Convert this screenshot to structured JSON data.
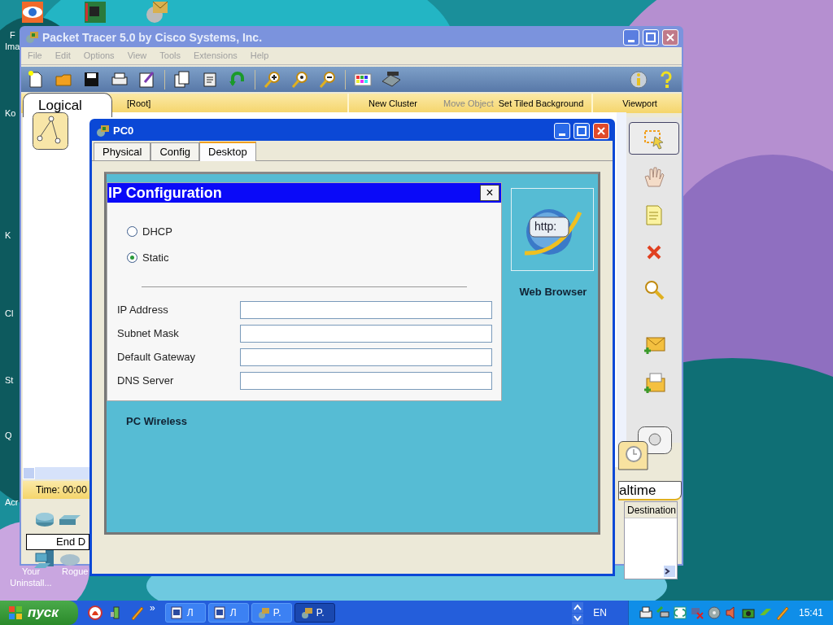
{
  "desktop": {
    "icon_labels": [
      {
        "text": "F"
      },
      {
        "text": "Ima"
      },
      {
        "text": "Ko"
      },
      {
        "text": "K"
      },
      {
        "text": "Cl"
      },
      {
        "text": "St"
      },
      {
        "text": "Q"
      },
      {
        "text": "Acr"
      }
    ],
    "bottom_icons": [
      {
        "text": "Your Uninstall..."
      },
      {
        "text": "Rogue"
      }
    ]
  },
  "main_window": {
    "title": "Packet Tracer 5.0 by Cisco Systems, Inc.",
    "menu": [
      "File",
      "Edit",
      "Options",
      "View",
      "Tools",
      "Extensions",
      "Help"
    ],
    "workspace_tab": "Logical",
    "root": "[Root]",
    "workspace_items": [
      {
        "label": "New Cluster",
        "disabled": false
      },
      {
        "label": "Move Object",
        "disabled": true
      },
      {
        "label": "Set Tiled Background",
        "disabled": false
      },
      {
        "label": "Viewport",
        "disabled": false
      }
    ],
    "time": "Time: 00:00",
    "end_device_box": "End D",
    "realtime_tab": "altime",
    "column_header": "Destination"
  },
  "pc_window": {
    "title": "PC0",
    "tabs": [
      {
        "label": "Physical",
        "selected": false
      },
      {
        "label": "Config",
        "selected": false
      },
      {
        "label": "Desktop",
        "selected": true
      }
    ],
    "web_browser": {
      "icon_text": "http:",
      "label": "Web Browser"
    },
    "pc_wireless": "PC Wireless",
    "ip_config": {
      "title": "IP Configuration",
      "close": "×",
      "modes": [
        {
          "label": "DHCP",
          "selected": false
        },
        {
          "label": "Static",
          "selected": true
        }
      ],
      "fields": [
        {
          "label": "IP Address"
        },
        {
          "label": "Subnet Mask"
        },
        {
          "label": "Default Gateway"
        },
        {
          "label": "DNS Server"
        }
      ]
    }
  },
  "taskbar": {
    "start": "пуск",
    "more": "»",
    "tasks": [
      {
        "label": "Л",
        "kind": "word",
        "selected": false
      },
      {
        "label": "Л",
        "kind": "word",
        "selected": false
      },
      {
        "label": "P.",
        "kind": "tracer",
        "selected": false
      },
      {
        "label": "P.",
        "kind": "tracer",
        "selected": true
      }
    ],
    "language": "EN",
    "clock": "15:41"
  }
}
